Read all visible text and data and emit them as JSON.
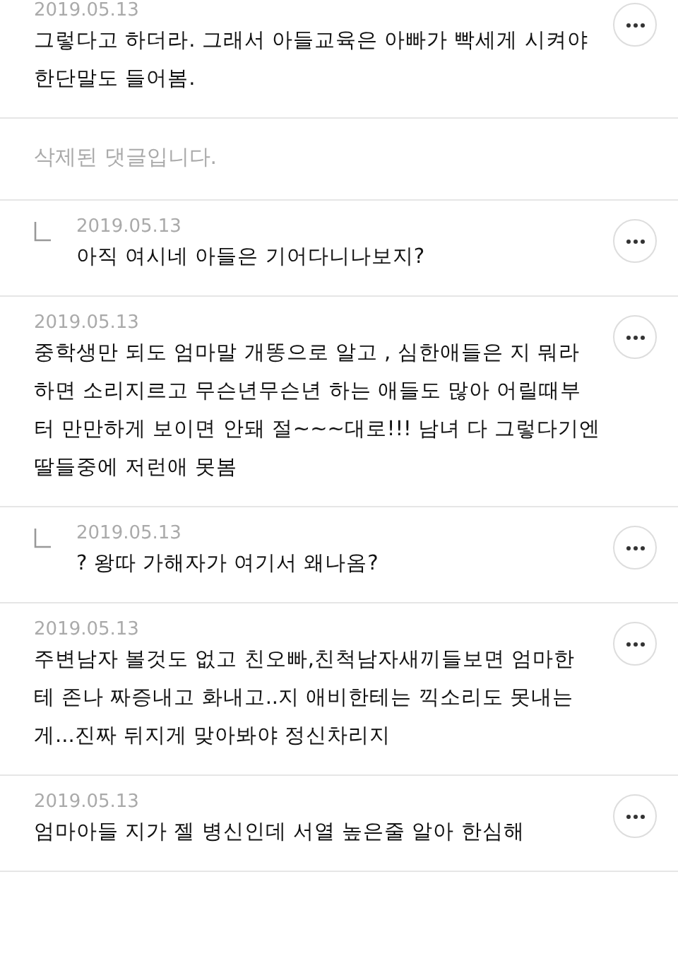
{
  "comments": [
    {
      "kind": "comment",
      "date": "2019.05.13",
      "text": "그렇다고 하더라. 그래서 아들교육은 아빠가 빡세게 시켜야\n한단말도 들어봄."
    },
    {
      "kind": "deleted",
      "text": "삭제된 댓글입니다."
    },
    {
      "kind": "reply",
      "date": "2019.05.13",
      "text": "아직 여시네 아들은 기어다니나보지?"
    },
    {
      "kind": "comment",
      "date": "2019.05.13",
      "text": "중학생만 되도 엄마말 개똥으로 알고 , 심한애들은 지 뭐라\n하면 소리지르고 무슨년무슨년 하는 애들도 많아 어릴때부\n터 만만하게 보이면 안돼 절~~~대로!!! 남녀 다 그렇다기엔\n딸들중에 저런애 못봄"
    },
    {
      "kind": "reply",
      "date": "2019.05.13",
      "text": "? 왕따 가해자가 여기서 왜나옴?"
    },
    {
      "kind": "comment",
      "date": "2019.05.13",
      "text": "주변남자 볼것도 없고 친오빠,친척남자새끼들보면 엄마한\n테 존나 짜증내고 화내고..지 애비한테는 끽소리도 못내는\n게...진짜 뒤지게 맞아봐야 정신차리지"
    },
    {
      "kind": "comment",
      "date": "2019.05.13",
      "text": "엄마아들 지가 젤 병신인데 서열 높은줄 알아 한심해"
    }
  ]
}
